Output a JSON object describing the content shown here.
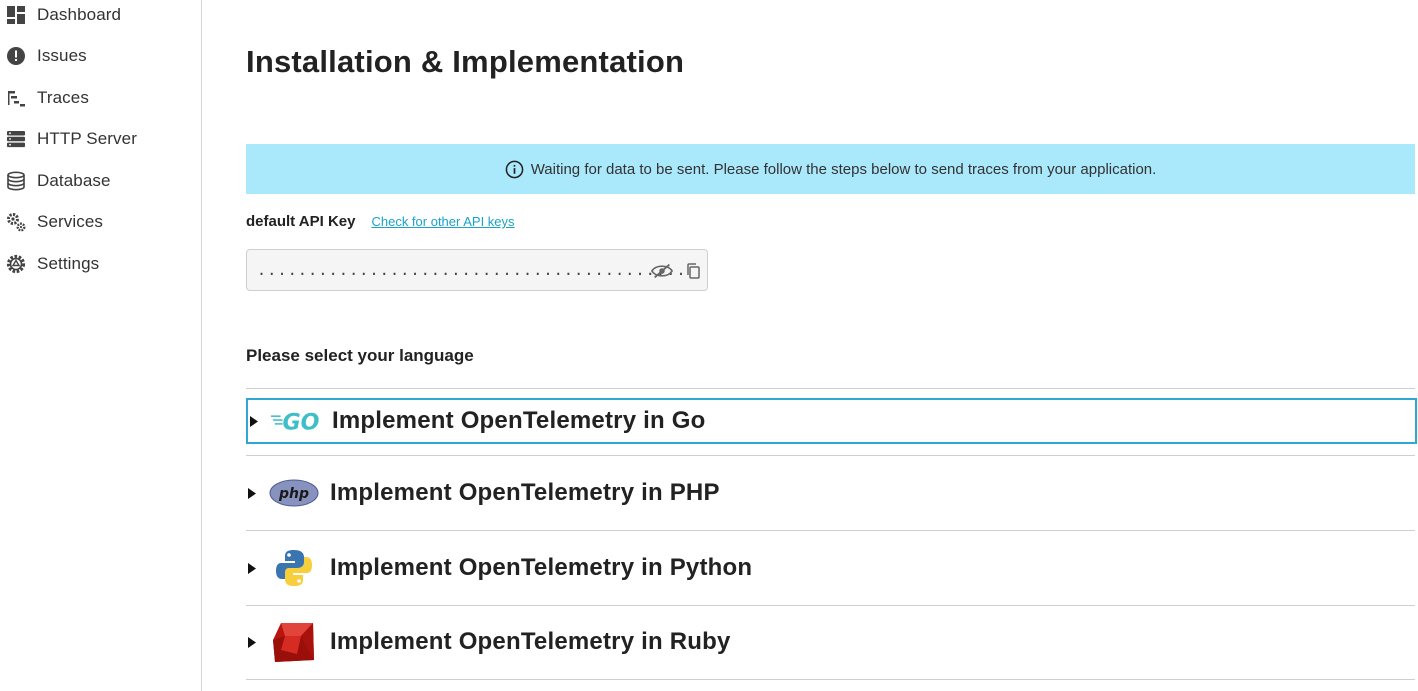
{
  "sidebar": {
    "items": [
      {
        "label": "Dashboard",
        "icon": "dashboard-icon"
      },
      {
        "label": "Issues",
        "icon": "alert-icon"
      },
      {
        "label": "Traces",
        "icon": "traces-icon"
      },
      {
        "label": "HTTP Server",
        "icon": "server-icon"
      },
      {
        "label": "Database",
        "icon": "database-icon"
      },
      {
        "label": "Services",
        "icon": "gears-icon"
      },
      {
        "label": "Settings",
        "icon": "settings-icon"
      }
    ]
  },
  "main": {
    "title": "Installation & Implementation",
    "banner": {
      "icon": "info-icon",
      "text": "Waiting for data to be sent. Please follow the steps below to send traces from your application."
    },
    "api_key": {
      "label": "default API Key",
      "link": "Check for other API keys",
      "masked_value": "..........................................",
      "toggle_icon": "eye-off-icon",
      "copy_icon": "copy-icon"
    },
    "languages": {
      "heading": "Please select your language",
      "items": [
        {
          "title": "Implement OpenTelemetry in Go",
          "logo": "go-logo",
          "logo_text": "GO"
        },
        {
          "title": "Implement OpenTelemetry in PHP",
          "logo": "php-logo",
          "logo_text": "php"
        },
        {
          "title": "Implement OpenTelemetry in Python",
          "logo": "python-logo"
        },
        {
          "title": "Implement OpenTelemetry in Ruby",
          "logo": "ruby-logo"
        }
      ]
    }
  },
  "colors": {
    "banner_bg": "#aae8fb",
    "link": "#1aa3c9",
    "focus_border": "#2ea8d3"
  }
}
